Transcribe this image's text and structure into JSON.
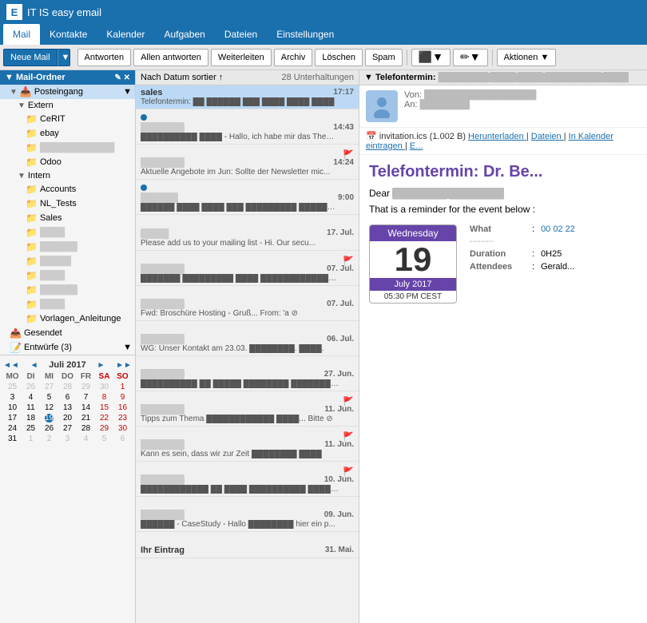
{
  "app": {
    "title": "IT IS easy email",
    "icon": "E"
  },
  "nav": {
    "items": [
      {
        "label": "Mail",
        "active": true
      },
      {
        "label": "Kontakte",
        "active": false
      },
      {
        "label": "Kalender",
        "active": false
      },
      {
        "label": "Aufgaben",
        "active": false
      },
      {
        "label": "Dateien",
        "active": false
      },
      {
        "label": "Einstellungen",
        "active": false
      }
    ]
  },
  "toolbar": {
    "new_mail": "Neue Mail",
    "reply": "Antworten",
    "reply_all": "Allen antworten",
    "forward": "Weiterleiten",
    "archive": "Archiv",
    "delete": "Löschen",
    "spam": "Spam",
    "actions": "Aktionen"
  },
  "sidebar": {
    "header": "Mail-Ordner",
    "folders": [
      {
        "label": "Posteingang",
        "level": 1,
        "icon": "▼",
        "selected": true,
        "expanded": true
      },
      {
        "label": "Extern",
        "level": 2,
        "icon": "▼",
        "expanded": true
      },
      {
        "label": "CeRIT",
        "level": 3,
        "icon": "📁"
      },
      {
        "label": "ebay",
        "level": 3,
        "icon": "📁"
      },
      {
        "label": "██████ ████",
        "level": 3,
        "icon": "📁",
        "blurred": true
      },
      {
        "label": "Odoo",
        "level": 3,
        "icon": "📁"
      },
      {
        "label": "Intern",
        "level": 2,
        "icon": "▼",
        "expanded": true
      },
      {
        "label": "Accounts",
        "level": 3,
        "icon": "📁"
      },
      {
        "label": "NL_Tests",
        "level": 3,
        "icon": "📁"
      },
      {
        "label": "Sales",
        "level": 3,
        "icon": "📁"
      },
      {
        "label": "████",
        "level": 3,
        "icon": "📁",
        "blurred": true
      },
      {
        "label": "██████",
        "level": 3,
        "icon": "📁",
        "blurred": true
      },
      {
        "label": "█████",
        "level": 3,
        "icon": "📁",
        "blurred": true
      },
      {
        "label": "████",
        "level": 3,
        "icon": "📁",
        "blurred": true
      },
      {
        "label": "██████",
        "level": 3,
        "icon": "📁",
        "blurred": true
      },
      {
        "label": "████",
        "level": 3,
        "icon": "📁",
        "blurred": true
      },
      {
        "label": "Vorlagen_Anleitunge",
        "level": 3,
        "icon": "📁"
      },
      {
        "label": "Gesendet",
        "level": 1,
        "icon": "📤"
      },
      {
        "label": "Entwürfe (3)",
        "level": 1,
        "icon": "📝"
      }
    ]
  },
  "mini_calendar": {
    "month_year": "Juli 2017",
    "days_header": [
      "MO",
      "DI",
      "MI",
      "DO",
      "FR",
      "SA",
      "SO"
    ],
    "weeks": [
      [
        "25",
        "26",
        "27",
        "28",
        "29",
        "30",
        "1"
      ],
      [
        "3",
        "4",
        "5",
        "6",
        "7",
        "8",
        "9"
      ],
      [
        "10",
        "11",
        "12",
        "13",
        "14",
        "15",
        "16"
      ],
      [
        "17",
        "18",
        "19",
        "20",
        "21",
        "22",
        "23"
      ],
      [
        "24",
        "25",
        "26",
        "27",
        "28",
        "29",
        "30"
      ],
      [
        "31",
        "1",
        "2",
        "3",
        "4",
        "5",
        "6"
      ]
    ],
    "today": "19",
    "other_month_start": [
      "25",
      "26",
      "27",
      "28",
      "29",
      "30"
    ],
    "other_month_end": [
      "1",
      "2",
      "3",
      "4",
      "5",
      "6"
    ]
  },
  "email_list": {
    "sort_label": "Nach Datum sortier ↑",
    "count_label": "28 Unterhaltungen",
    "emails": [
      {
        "sender": "sales",
        "time": "17:17",
        "subject": "Telefontermin: ██ ██████ ███ ████ ████ ████",
        "selected": true,
        "unread": false
      },
      {
        "sender": "██████ ████",
        "time": "14:43",
        "subject": "██████████ ████ - Hallo, ich habe mir das Thema üb...",
        "selected": false,
        "unread": true
      },
      {
        "sender": "██████ ████",
        "time": "14:24",
        "subject": "Aktuelle Angebote im Jun: Sollte der Newsletter mic...",
        "selected": false,
        "unread": false,
        "flag": true
      },
      {
        "sender": "█████ ██████ █████",
        "time": "9:00",
        "subject": "██████ ████ ████ ███ █████████ ██████████",
        "selected": false,
        "unread": true,
        "attachment": true
      },
      {
        "sender": "▶ ██████ ██████████ - ⊘",
        "time": "17. Jul.",
        "subject": "Please add us to your mailing list - Hi. Our secu...",
        "selected": false,
        "unread": false
      },
      {
        "sender": "████ █████",
        "time": "07. Jul.",
        "subject": "███████ █████████ ████ ████████████████",
        "selected": false,
        "unread": false,
        "flag": true
      },
      {
        "sender": "██████ ████",
        "time": "07. Jul.",
        "subject": "Fwd: Broschüre Hosting - Gruß... From: 'a ⊘",
        "selected": false,
        "unread": false
      },
      {
        "sender": "██████ ██",
        "time": "06. Jul.",
        "subject": "WG: Unser Kontakt am 23.03. ████████. ████.",
        "selected": false,
        "unread": false
      },
      {
        "sender": "████ ████",
        "time": "27. Jun.",
        "subject": "██████████ ██ █████ ████████ █████████████",
        "selected": false,
        "unread": false
      },
      {
        "sender": "████ █████",
        "time": "11. Jun.",
        "subject": "Tipps zum Thema ████████████ ████... Bitte ⊘",
        "selected": false,
        "unread": false,
        "flag": true
      },
      {
        "sender": "████ █████",
        "time": "11. Jun.",
        "subject": "Kann es sein, dass wir zur Zeit ████████ ████",
        "selected": false,
        "unread": false,
        "flag": true
      },
      {
        "sender": "████ █████",
        "time": "10. Jun.",
        "subject": "████████████ ██ ████ ██████████ ██████",
        "selected": false,
        "unread": false,
        "flag": true
      },
      {
        "sender": "██████ ████",
        "time": "09. Jun.",
        "subject": "██████ - CaseStudy - Hallo ████████ hier ein p...",
        "selected": false,
        "unread": false
      },
      {
        "sender": "Ihr Eintrag",
        "time": "31. Mai.",
        "subject": "",
        "selected": false,
        "unread": false
      }
    ]
  },
  "preview": {
    "subject_header": "Telefontermin: ██ ████████ ████ ████████ ████",
    "from_label": "Von:",
    "from_value": "████████ ████████████",
    "to_label": "An:",
    "to_value": "████████",
    "attachment": {
      "name": "invitation.ics",
      "size": "1.002 B",
      "download": "Herunterladen",
      "files": "Dateien",
      "calendar": "In Kalender eintragen",
      "more": "E..."
    },
    "title": "Telefontermin: Dr. Be...",
    "greeting": "Dear ████████ ████████",
    "body": "That is a reminder for the event below :",
    "calendar": {
      "day_name": "Wednesday",
      "day_num": "19",
      "month_year": "July 2017",
      "time": "05:30 PM CEST",
      "what_label": "What",
      "what_value": "00 02 22",
      "duration_label": "Duration",
      "duration_value": "0H25",
      "attendees_label": "Attendees",
      "attendees_value": "Gerald..."
    }
  }
}
